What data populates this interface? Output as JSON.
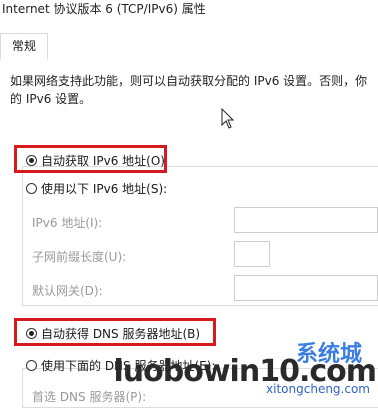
{
  "window": {
    "title": "Internet 协议版本 6 (TCP/IPv6) 属性"
  },
  "tabs": [
    {
      "label": "常规"
    }
  ],
  "description": "如果网络支持此功能，则可以自动获取分配的 IPv6 设置。否则，你的 IPv6 设置。",
  "ip_section": {
    "auto_label": "自动获取 IPv6 地址(O)",
    "auto_checked": true,
    "manual_label": "使用以下 IPv6 地址(S):",
    "fields": [
      {
        "label": "IPv6 地址(I):",
        "value": ""
      },
      {
        "label": "子网前缀长度(U):",
        "value": ""
      },
      {
        "label": "默认网关(D):",
        "value": ""
      }
    ]
  },
  "dns_section": {
    "auto_label": "自动获得 DNS 服务器地址(B)",
    "auto_checked": true,
    "manual_label": "使用下面的 DNS 服务器地址(E):",
    "preferred_label": "首选 DNS 服务器(P):"
  },
  "watermark": {
    "logo_text": "系统城",
    "main": "luobowin10.com",
    "sub": "xitongcheng.com"
  },
  "colors": {
    "highlight_box": "#d71a20",
    "watermark_blue": "#2f63c8"
  }
}
